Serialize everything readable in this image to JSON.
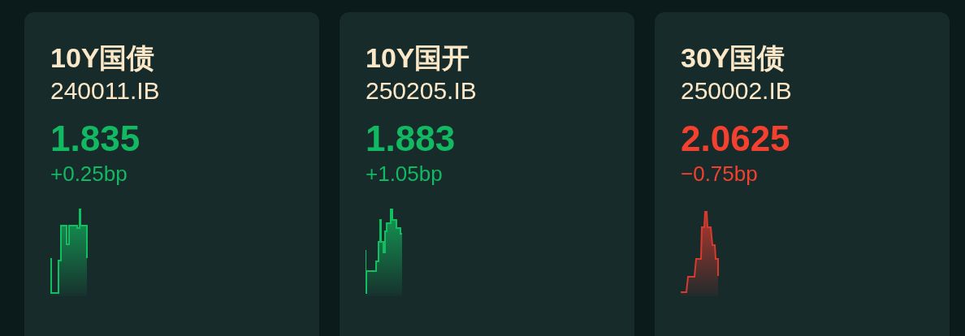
{
  "cards": [
    {
      "kind": "up",
      "name": "10Y国债",
      "code": "240011.IB",
      "value": "1.835",
      "change": "+0.25bp"
    },
    {
      "kind": "up",
      "name": "10Y国开",
      "code": "250205.IB",
      "value": "1.883",
      "change": "+1.05bp"
    },
    {
      "kind": "down",
      "name": "30Y国债",
      "code": "250002.IB",
      "value": "2.0625",
      "change": "−0.75bp"
    }
  ]
}
